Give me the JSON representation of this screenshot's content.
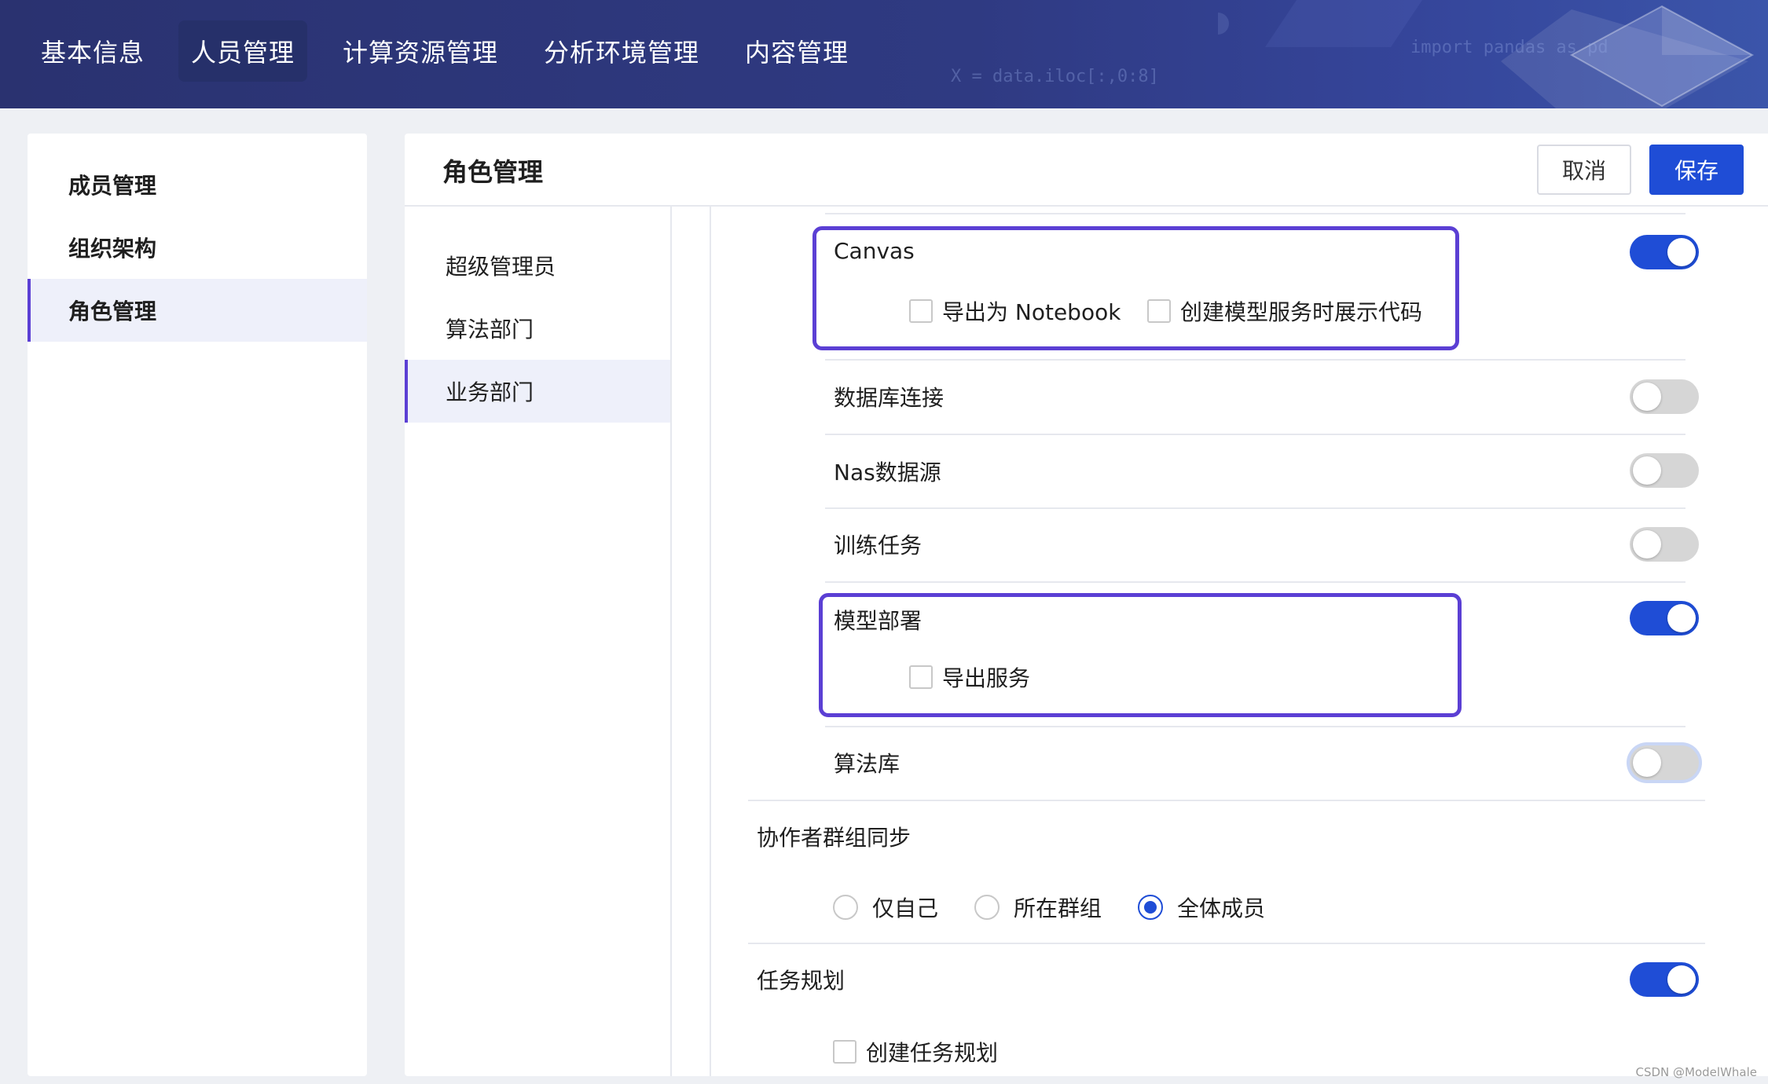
{
  "nav": {
    "items": [
      "基本信息",
      "人员管理",
      "计算资源管理",
      "分析环境管理",
      "内容管理"
    ],
    "active_index": 1,
    "decor_code": [
      "import pandas as pd",
      "X = data.iloc[:,0:8]"
    ]
  },
  "sidebar": {
    "items": [
      "成员管理",
      "组织架构",
      "角色管理"
    ],
    "active_index": 2
  },
  "panel": {
    "title": "角色管理",
    "cancel_label": "取消",
    "save_label": "保存"
  },
  "roles": {
    "items": [
      "超级管理员",
      "算法部门",
      "业务部门"
    ],
    "active_index": 2
  },
  "permissions": {
    "canvas": {
      "label": "Canvas",
      "enabled": true,
      "options": [
        "导出为 Notebook",
        "创建模型服务时展示代码"
      ]
    },
    "db_connection": {
      "label": "数据库连接",
      "enabled": false
    },
    "nas_source": {
      "label": "Nas数据源",
      "enabled": false
    },
    "training": {
      "label": "训练任务",
      "enabled": false
    },
    "model_deploy": {
      "label": "模型部署",
      "enabled": true,
      "options": [
        "导出服务"
      ]
    },
    "algo_lib": {
      "label": "算法库",
      "enabled": false
    }
  },
  "collab_sync": {
    "label": "协作者群组同步",
    "options": [
      "仅自己",
      "所在群组",
      "全体成员"
    ],
    "selected_index": 2
  },
  "task_plan": {
    "label": "任务规划",
    "enabled": true,
    "options": [
      "创建任务规划"
    ]
  },
  "watermark": "CSDN @ModelWhale",
  "colors": {
    "nav_bg": "#2f3a82",
    "accent": "#1f4dd6",
    "highlight": "#5b3fd4",
    "toggle_off": "#d6d6d6"
  }
}
